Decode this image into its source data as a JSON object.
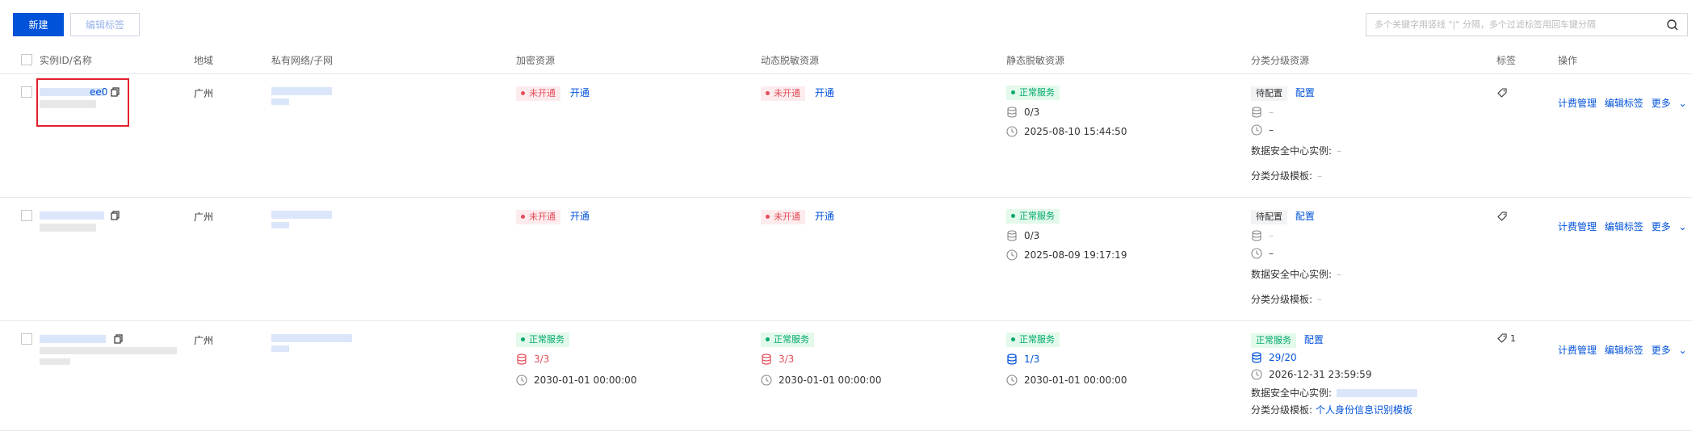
{
  "toolbar": {
    "new_label": "新建",
    "edit_tags_label": "编辑标签",
    "search_placeholder": "多个关键字用竖线 \"|\" 分隔，多个过滤标签用回车键分隔"
  },
  "table": {
    "headers": {
      "instance": "实例ID/名称",
      "region": "地域",
      "vpc": "私有网络/子网",
      "encryption": "加密资源",
      "dynamic_masking": "动态脱敏资源",
      "static_masking": "静态脱敏资源",
      "classification": "分类分级资源",
      "tags": "标签",
      "actions": "操作"
    },
    "rows": [
      {
        "id_suffix": "ee0",
        "region": "广州",
        "encryption": {
          "status": "未开通",
          "action": "开通"
        },
        "dynamic": {
          "status": "未开通",
          "action": "开通"
        },
        "static": {
          "status": "正常服务",
          "db_count": "0/3",
          "time": "2025-08-10 15:44:50"
        },
        "classification": {
          "status": "待配置",
          "action": "配置",
          "db_value": "–",
          "time_value": "–",
          "dsc_label": "数据安全中心实例:",
          "dsc_value": "–",
          "template_label": "分类分级模板:",
          "template_value": "–"
        },
        "tag_count": "",
        "actions": {
          "billing": "计费管理",
          "edit_tags": "编辑标签",
          "more": "更多"
        }
      },
      {
        "id_suffix": "",
        "region": "广州",
        "encryption": {
          "status": "未开通",
          "action": "开通"
        },
        "dynamic": {
          "status": "未开通",
          "action": "开通"
        },
        "static": {
          "status": "正常服务",
          "db_count": "0/3",
          "time": "2025-08-09 19:17:19"
        },
        "classification": {
          "status": "待配置",
          "action": "配置",
          "db_value": "–",
          "time_value": "–",
          "dsc_label": "数据安全中心实例:",
          "dsc_value": "–",
          "template_label": "分类分级模板:",
          "template_value": "–"
        },
        "tag_count": "",
        "actions": {
          "billing": "计费管理",
          "edit_tags": "编辑标签",
          "more": "更多"
        }
      },
      {
        "id_suffix": "",
        "region": "广州",
        "encryption": {
          "status": "正常服务",
          "db_count": "3/3",
          "time": "2030-01-01 00:00:00"
        },
        "dynamic": {
          "status": "正常服务",
          "db_count": "3/3",
          "time": "2030-01-01 00:00:00"
        },
        "static": {
          "status": "正常服务",
          "db_count": "1/3",
          "time": "2030-01-01 00:00:00"
        },
        "classification": {
          "status": "正常服务",
          "action": "配置",
          "db_value": "29/20",
          "time_value": "2026-12-31 23:59:59",
          "dsc_label": "数据安全中心实例:",
          "template_label": "分类分级模板:",
          "template_value": "个人身份信息识别模板"
        },
        "tag_count": "1",
        "actions": {
          "billing": "计费管理",
          "edit_tags": "编辑标签",
          "more": "更多"
        }
      }
    ]
  },
  "colors": {
    "primary": "#0052d9",
    "danger": "#e34d59",
    "success": "#00a870",
    "highlight_box": "#e0212b"
  }
}
